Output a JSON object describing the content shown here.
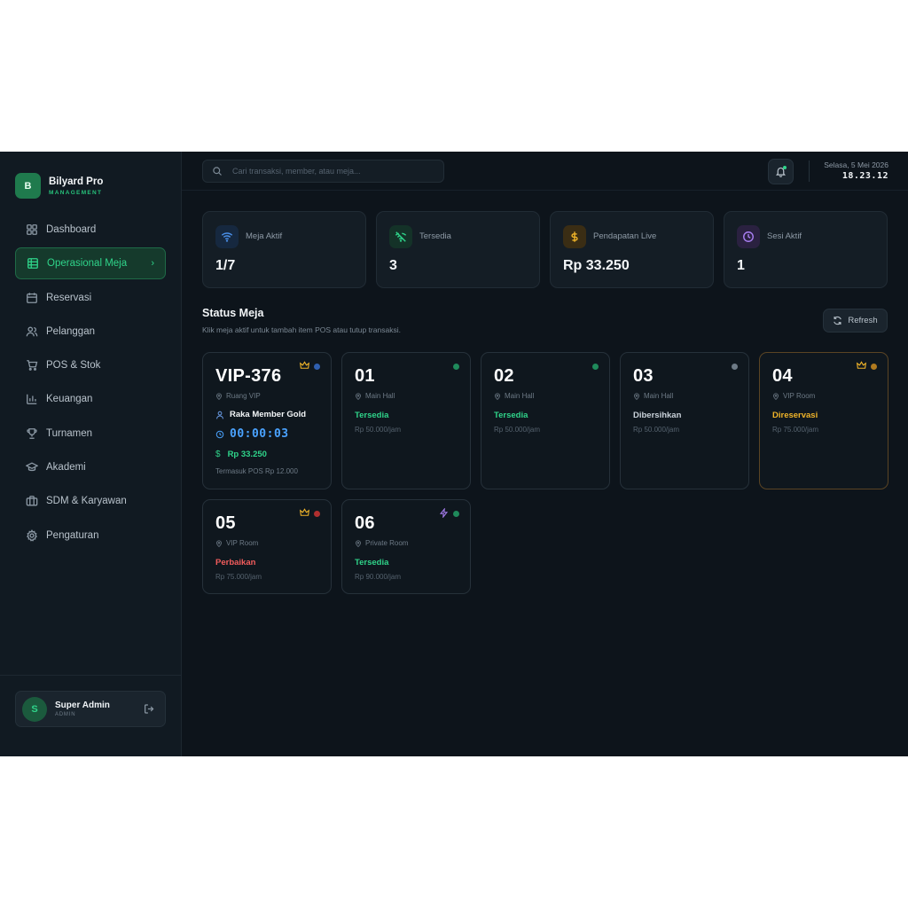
{
  "brand": {
    "logo_letter": "B",
    "name": "Bilyard Pro",
    "subtitle": "MANAGEMENT",
    "accent": "#2fd48a"
  },
  "nav": [
    {
      "label": "Dashboard",
      "icon": "grid-icon",
      "active": false
    },
    {
      "label": "Operasional Meja",
      "icon": "table-icon",
      "active": true
    },
    {
      "label": "Reservasi",
      "icon": "calendar-icon",
      "active": false
    },
    {
      "label": "Pelanggan",
      "icon": "users-icon",
      "active": false
    },
    {
      "label": "POS & Stok",
      "icon": "cart-icon",
      "active": false
    },
    {
      "label": "Keuangan",
      "icon": "bar-chart-icon",
      "active": false
    },
    {
      "label": "Turnamen",
      "icon": "trophy-icon",
      "active": false
    },
    {
      "label": "Akademi",
      "icon": "graduation-cap-icon",
      "active": false
    },
    {
      "label": "SDM & Karyawan",
      "icon": "briefcase-icon",
      "active": false
    },
    {
      "label": "Pengaturan",
      "icon": "gear-icon",
      "active": false
    }
  ],
  "user": {
    "initial": "S",
    "name": "Super Admin",
    "role": "ADMIN"
  },
  "topbar": {
    "search_placeholder": "Cari transaksi, member, atau meja...",
    "date": "Selasa, 5 Mei 2026",
    "time": "18.23.12"
  },
  "stats": [
    {
      "label": "Meja Aktif",
      "value": "1/7",
      "icon": "wifi-icon",
      "color": "#4a8fe8"
    },
    {
      "label": "Tersedia",
      "value": "3",
      "icon": "wifi-off-icon",
      "color": "#2fd48a"
    },
    {
      "label": "Pendapatan Live",
      "value": "Rp 33.250",
      "icon": "dollar-icon",
      "color": "#f0b429"
    },
    {
      "label": "Sesi Aktif",
      "value": "1",
      "icon": "clock-icon",
      "color": "#a77ef0"
    }
  ],
  "section": {
    "title": "Status Meja",
    "subtitle": "Klik meja aktif untuk tambah item POS atau tutup transaksi.",
    "refresh_label": "Refresh"
  },
  "tables": {
    "vip376": {
      "number": "VIP-376",
      "location": "Ruang VIP",
      "member": "Raka Member Gold",
      "timer": "00:00:03",
      "amount": "Rp 33.250",
      "currency_symbol": "$",
      "pos_note": "Termasuk POS Rp 12.000",
      "dot_color": "#2f5fb0"
    },
    "t01": {
      "number": "01",
      "location": "Main Hall",
      "status": "Tersedia",
      "rate": "Rp 50.000/jam",
      "dot_color": "#1f8a5b"
    },
    "t02": {
      "number": "02",
      "location": "Main Hall",
      "status": "Tersedia",
      "rate": "Rp 50.000/jam",
      "dot_color": "#1f8a5b"
    },
    "t03": {
      "number": "03",
      "location": "Main Hall",
      "status": "Dibersihkan",
      "rate": "Rp 50.000/jam",
      "dot_color": "#6d7a86"
    },
    "t04": {
      "number": "04",
      "location": "VIP Room",
      "status": "Direservasi",
      "rate": "Rp 75.000/jam",
      "dot_color": "#b07a1f"
    },
    "t05": {
      "number": "05",
      "location": "VIP Room",
      "status": "Perbaikan",
      "rate": "Rp 75.000/jam",
      "dot_color": "#b02f2f"
    },
    "t06": {
      "number": "06",
      "location": "Private Room",
      "status": "Tersedia",
      "rate": "Rp 90.000/jam",
      "dot_color": "#1f8a5b"
    }
  },
  "status_colors": {
    "available": "#2fd48a",
    "cleaning": "#c9d2da",
    "reserved": "#f0b429",
    "repair": "#f25c5c"
  }
}
